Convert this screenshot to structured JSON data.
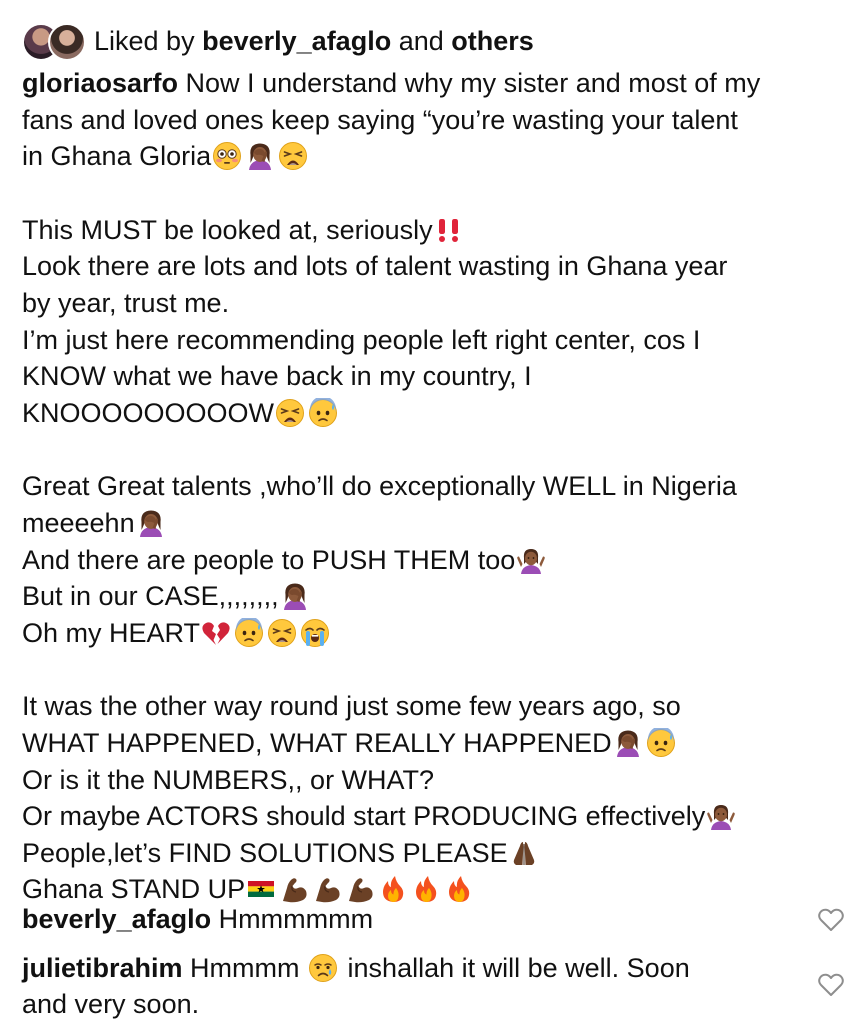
{
  "liked_by": {
    "prefix": "Liked by",
    "user": "beverly_afaglo",
    "middle": "and",
    "others": "others"
  },
  "post": {
    "username": "gloriaosarfo",
    "lines": {
      "l1": "Now I understand why my sister and most of my",
      "l2": "fans and loved ones keep saying “you’re wasting your talent",
      "l3": "in Ghana Gloria",
      "l5": "This MUST be looked at, seriously",
      "l6": "Look there are lots and lots of talent wasting in Ghana year",
      "l7": "by year, trust me.",
      "l8": "I’m just here recommending people left right center, cos I",
      "l9": "KNOW what we have back in my country, I",
      "l10": "KNOOOOOOOOOW",
      "l12": "Great Great talents ,who’ll do exceptionally WELL in Nigeria",
      "l13": "meeeehn",
      "l14": "And there are people to PUSH THEM too",
      "l15": "But in our CASE,,,,,,,,",
      "l16": "Oh my HEART",
      "l18": "It was the other way round just some few years ago, so",
      "l19": "WHAT HAPPENED, WHAT REALLY HAPPENED",
      "l20": "Or is it the NUMBERS,, or WHAT?",
      "l21": "Or maybe ACTORS should start PRODUCING effectively",
      "l22": "People,let’s FIND SOLUTIONS PLEASE",
      "l23": "Ghana STAND UP"
    }
  },
  "comments": [
    {
      "username": "beverly_afaglo",
      "text": "Hmmmmmm"
    },
    {
      "username": "julietibrahim",
      "text_a": "Hmmmm",
      "text_b": "inshallah it will be well. Soon",
      "text_c": "and very soon."
    }
  ],
  "icons": {
    "emoji_flushed": "flushed-face",
    "emoji_facepalm": "woman-facepalming",
    "emoji_weary": "weary-face",
    "emoji_exclamation": "double-exclamation",
    "emoji_fearful": "anxious-face-with-sweat",
    "emoji_shrug": "woman-shrugging",
    "emoji_broken_heart": "broken-heart",
    "emoji_sob": "loudly-crying-face",
    "emoji_pray": "folded-hands",
    "emoji_flag": "flag-ghana",
    "emoji_muscle": "flexed-biceps",
    "emoji_fire": "fire",
    "emoji_cry": "crying-face",
    "like": "heart-outline-icon"
  },
  "colors": {
    "text": "#111111",
    "emoji_yellow": "#FFC83D",
    "red": "#E0245E",
    "skin": "#8D5A3B",
    "heart_outline": "#8e8e8e"
  }
}
